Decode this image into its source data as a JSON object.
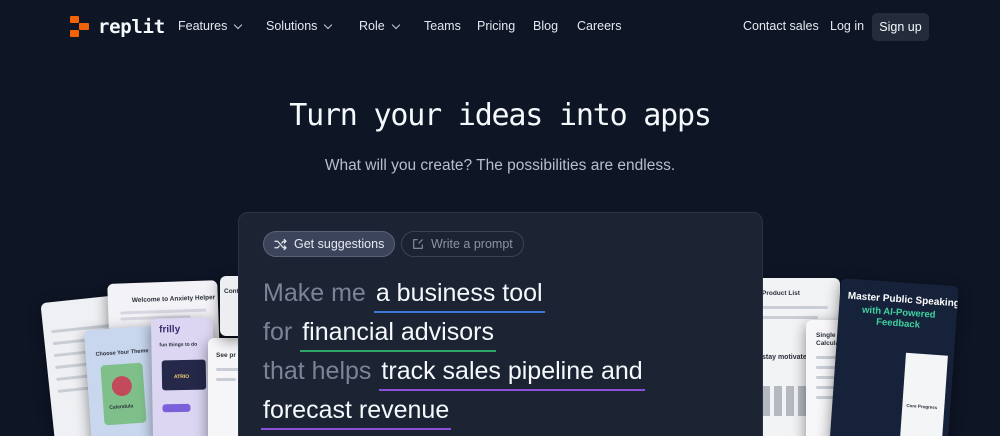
{
  "brand": {
    "name": "replit",
    "accent": "#f26207"
  },
  "nav": {
    "items": [
      {
        "label": "Features",
        "dropdown": true
      },
      {
        "label": "Solutions",
        "dropdown": true
      },
      {
        "label": "Role",
        "dropdown": true
      },
      {
        "label": "Teams",
        "dropdown": false
      },
      {
        "label": "Pricing",
        "dropdown": false
      },
      {
        "label": "Blog",
        "dropdown": false
      },
      {
        "label": "Careers",
        "dropdown": false
      }
    ],
    "contact_sales": "Contact sales",
    "log_in": "Log in",
    "sign_up": "Sign up"
  },
  "hero": {
    "title": "Turn your ideas into apps",
    "subtitle": "What will you create? The possibilities are endless."
  },
  "prompt_panel": {
    "get_suggestions": "Get suggestions",
    "write_prompt": "Write a prompt",
    "line1_prefix": "Make me",
    "line1_value": "a business tool",
    "line2_prefix": "for",
    "line2_value": "financial advisors",
    "line3_prefix": "that helps",
    "line3_value": "track sales pipeline and",
    "line4_value": "forecast revenue",
    "colors": {
      "blue": "#3c79d6",
      "green": "#2fa56a",
      "purple": "#8c4fd9"
    }
  },
  "preview_cards": {
    "left": {
      "anxiety_title": "Welcome to Anxiety Helper",
      "choose_theme": "Choose Your Theme",
      "calendula": "Calendula",
      "frilly": "frilly",
      "fun_things": "fun things to do",
      "atrio": "ATRIO",
      "see_pr": "See pr",
      "cont": "Cont"
    },
    "right": {
      "product_list": "Product List",
      "loan_calc": "Single Property Loan Calculator",
      "stay_motivated": "stay motivated",
      "speaking_title": "Master Public Speaking",
      "speaking_sub": "with AI-Powered Feedback",
      "speaking_accent": "#3fd3a0",
      "core_prog": "Core Progress"
    }
  }
}
